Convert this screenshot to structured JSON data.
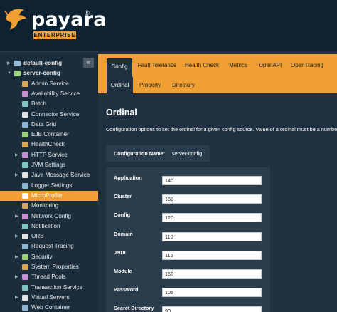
{
  "brand": {
    "name": "payara",
    "reg": "®",
    "edition": "ENTERPRISE"
  },
  "sidebar": {
    "collapse_label": "«",
    "items": [
      {
        "label": "default-config",
        "level": 0,
        "icon": "server-config-icon",
        "expandable": true
      },
      {
        "label": "server-config",
        "level": 0,
        "icon": "server-config-icon",
        "expandable": true,
        "expanded": true
      },
      {
        "label": "Admin Service",
        "level": 1,
        "icon": "admin-service-icon"
      },
      {
        "label": "Availability Service",
        "level": 1,
        "icon": "availability-service-icon"
      },
      {
        "label": "Batch",
        "level": 1,
        "icon": "batch-icon"
      },
      {
        "label": "Connector Service",
        "level": 1,
        "icon": "connector-service-icon"
      },
      {
        "label": "Data Grid",
        "level": 1,
        "icon": "data-grid-icon"
      },
      {
        "label": "EJB Container",
        "level": 1,
        "icon": "ejb-container-icon"
      },
      {
        "label": "HealthCheck",
        "level": 1,
        "icon": "healthcheck-icon"
      },
      {
        "label": "HTTP Service",
        "level": 1,
        "icon": "http-service-icon",
        "expandable": true
      },
      {
        "label": "JVM Settings",
        "level": 1,
        "icon": "jvm-settings-icon"
      },
      {
        "label": "Java Message Service",
        "level": 1,
        "icon": "java-message-service-icon",
        "expandable": true
      },
      {
        "label": "Logger Settings",
        "level": 1,
        "icon": "logger-settings-icon"
      },
      {
        "label": "MicroProfile",
        "level": 1,
        "icon": "microprofile-icon",
        "selected": true
      },
      {
        "label": "Monitoring",
        "level": 1,
        "icon": "monitoring-icon"
      },
      {
        "label": "Network Config",
        "level": 1,
        "icon": "network-config-icon",
        "expandable": true
      },
      {
        "label": "Notification",
        "level": 1,
        "icon": "notification-icon"
      },
      {
        "label": "ORB",
        "level": 1,
        "icon": "orb-icon",
        "expandable": true
      },
      {
        "label": "Request Tracing",
        "level": 1,
        "icon": "request-tracing-icon"
      },
      {
        "label": "Security",
        "level": 1,
        "icon": "security-icon",
        "expandable": true
      },
      {
        "label": "System Properties",
        "level": 1,
        "icon": "system-properties-icon"
      },
      {
        "label": "Thread Pools",
        "level": 1,
        "icon": "thread-pools-icon",
        "expandable": true
      },
      {
        "label": "Transaction Service",
        "level": 1,
        "icon": "transaction-service-icon"
      },
      {
        "label": "Virtual Servers",
        "level": 1,
        "icon": "virtual-servers-icon",
        "expandable": true
      },
      {
        "label": "Web Container",
        "level": 1,
        "icon": "web-container-icon"
      }
    ]
  },
  "tabs": [
    {
      "label": "Config",
      "active": true
    },
    {
      "label": "Fault Tolerance"
    },
    {
      "label": "Health Check"
    },
    {
      "label": "Metrics"
    },
    {
      "label": "OpenAPI"
    },
    {
      "label": "OpenTracing"
    }
  ],
  "subtabs": [
    {
      "label": "Ordinal",
      "active": true
    },
    {
      "label": "Property"
    },
    {
      "label": "Directory"
    }
  ],
  "page": {
    "title": "Ordinal",
    "description": "Configuration options to set the ordinal for a given config source. Value of a ordinal must be a number",
    "config_name_label": "Configuration Name:",
    "config_name_value": "server-config"
  },
  "ordinals": [
    {
      "label": "Application",
      "value": "140"
    },
    {
      "label": "Cluster",
      "value": "160"
    },
    {
      "label": "Config",
      "value": "120"
    },
    {
      "label": "Domain",
      "value": "110"
    },
    {
      "label": "JNDI",
      "value": "115"
    },
    {
      "label": "Module",
      "value": "150"
    },
    {
      "label": "Password",
      "value": "105"
    },
    {
      "label": "Secret Directory",
      "value": "90"
    }
  ],
  "colors": {
    "accent": "#f0a033",
    "header_bg": "#0e2231",
    "sidebar_bg": "#1b2d3b",
    "content_bg": "#1f3140",
    "panel_bg": "#2b3d4c"
  }
}
